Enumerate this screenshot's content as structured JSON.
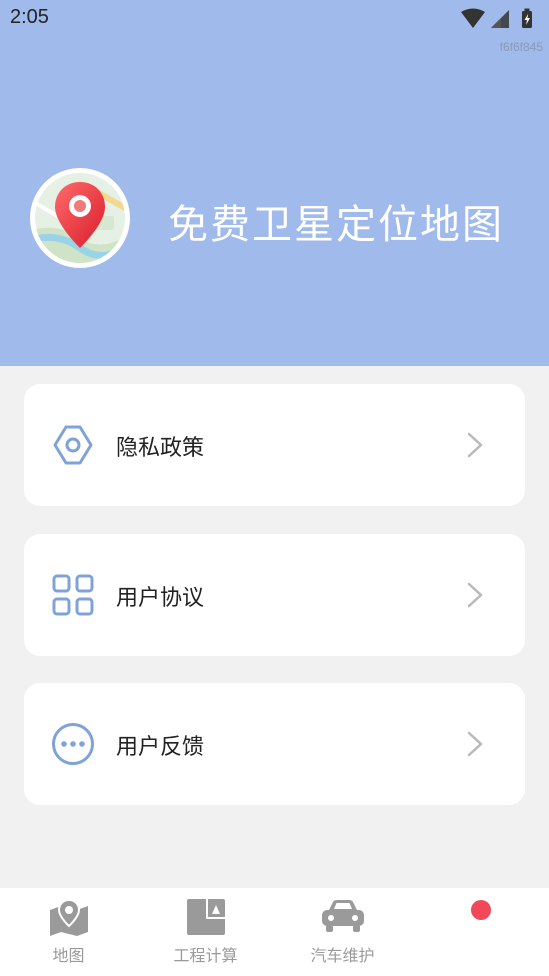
{
  "status_bar": {
    "time": "2:05",
    "build_tag": "f6f6f845"
  },
  "header": {
    "title": "免费卫星定位地图",
    "background": "#a0bbeb"
  },
  "menu": {
    "items": [
      {
        "label": "隐私政策",
        "icon": "gear-icon"
      },
      {
        "label": "用户协议",
        "icon": "grid-icon"
      },
      {
        "label": "用户反馈",
        "icon": "more-dots-icon"
      }
    ],
    "icon_color": "#7fa3d8",
    "chevron_color": "#b9b9b9"
  },
  "tabbar": {
    "tabs": [
      {
        "label": "地图",
        "icon": "map-icon"
      },
      {
        "label": "工程计算",
        "icon": "calculator-icon"
      },
      {
        "label": "汽车维护",
        "icon": "car-icon"
      },
      {
        "label": "",
        "icon": "record-dot-icon"
      }
    ],
    "inactive_color": "#9a9a9a",
    "dot_color": "#f2495a"
  }
}
